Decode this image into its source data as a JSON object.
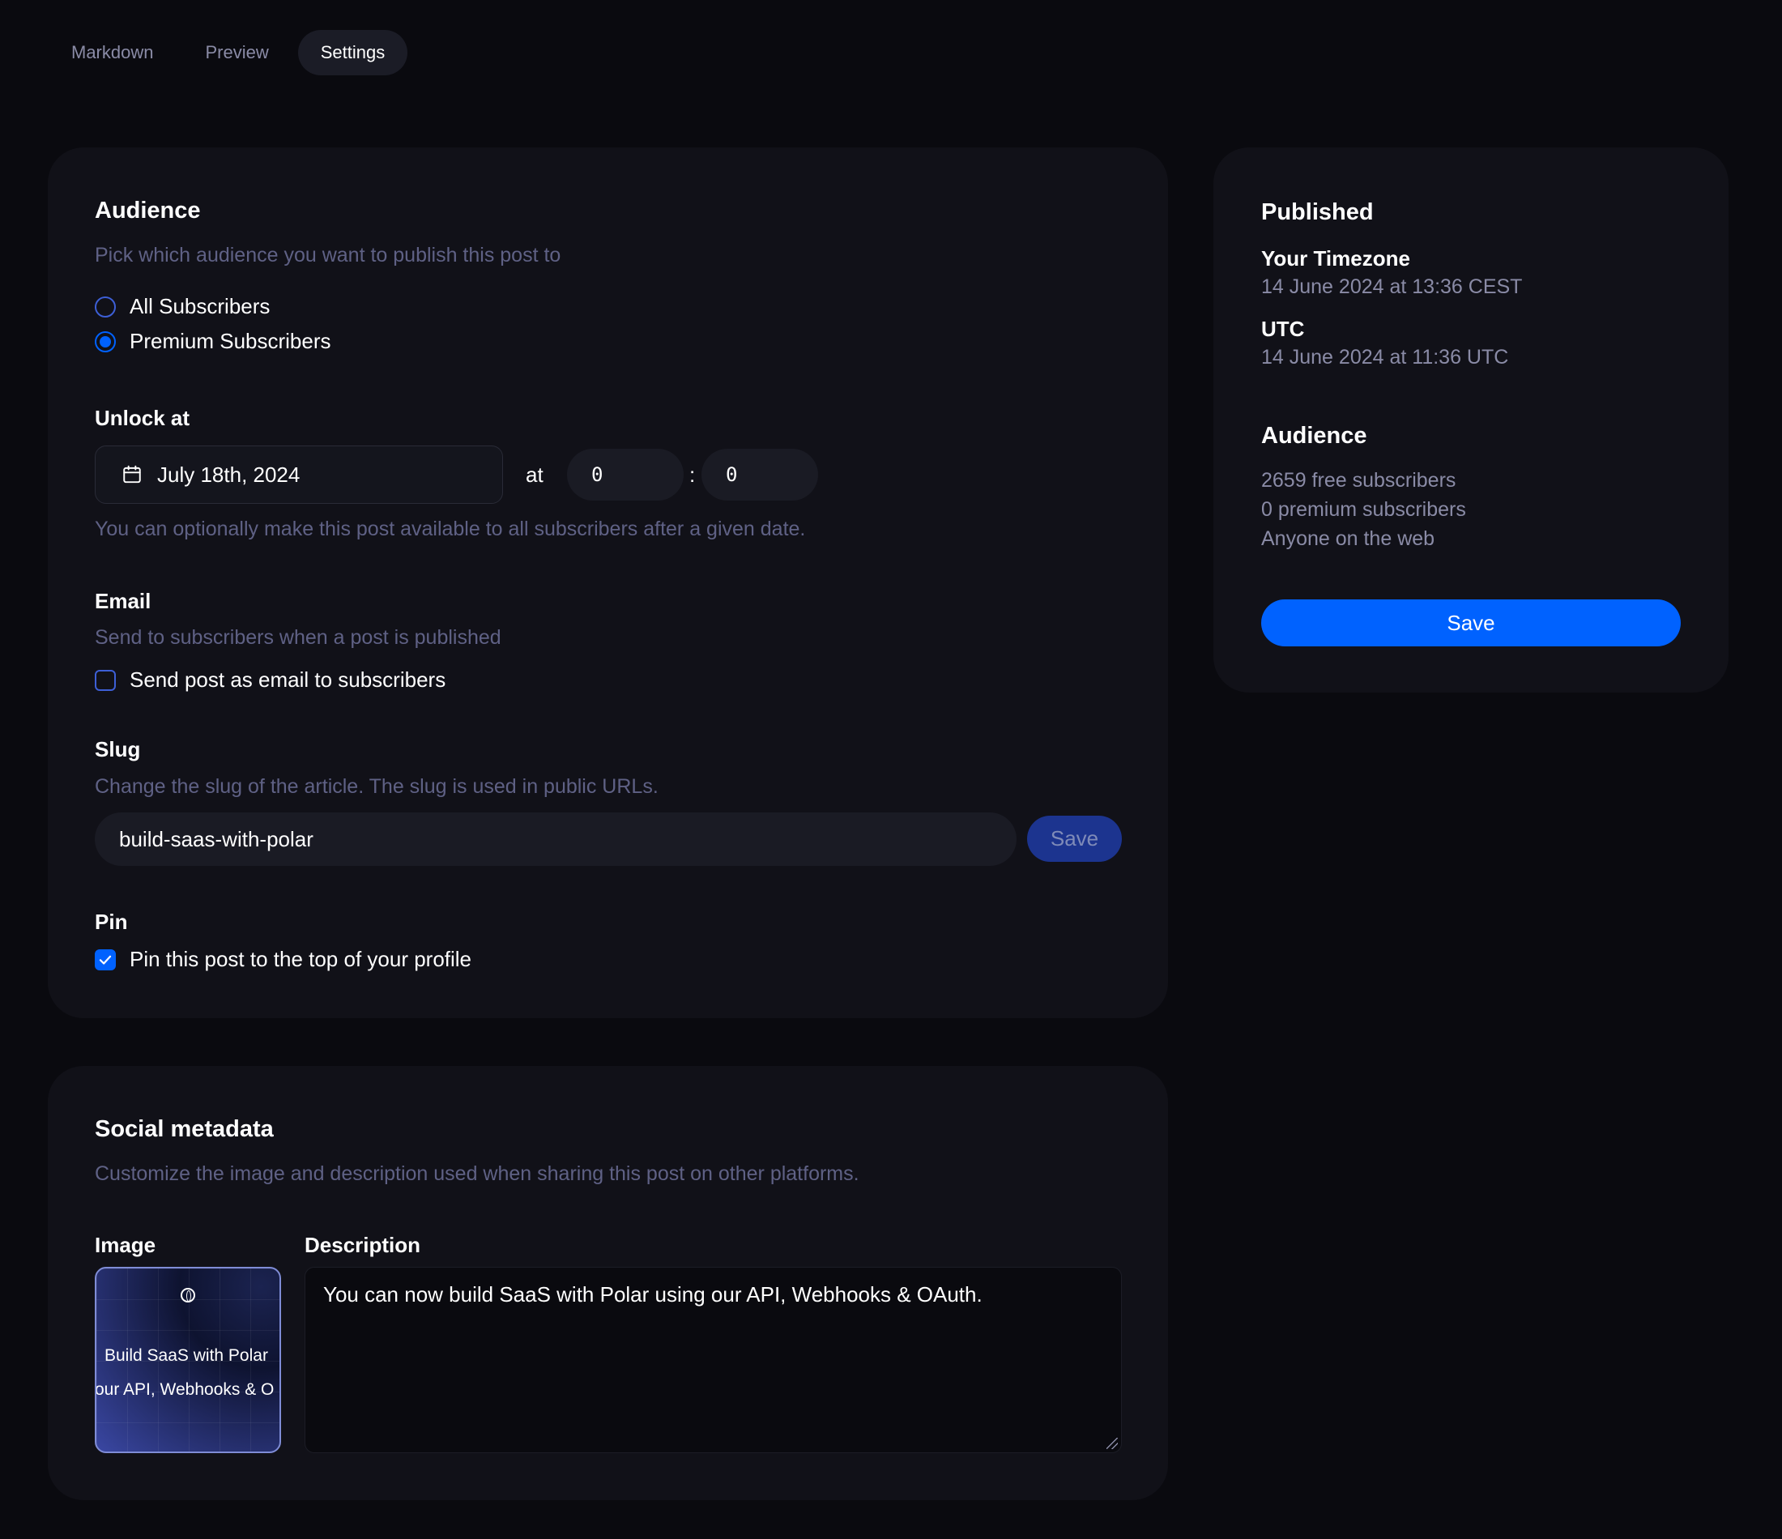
{
  "tabs": [
    {
      "label": "Markdown",
      "active": false
    },
    {
      "label": "Preview",
      "active": false
    },
    {
      "label": "Settings",
      "active": true
    }
  ],
  "audience": {
    "title": "Audience",
    "description": "Pick which audience you want to publish this post to",
    "options": [
      {
        "label": "All Subscribers",
        "checked": false
      },
      {
        "label": "Premium Subscribers",
        "checked": true
      }
    ]
  },
  "unlock": {
    "title": "Unlock at",
    "date": "July 18th, 2024",
    "at_label": "at",
    "hour": "0",
    "separator": ":",
    "minute": "0",
    "help": "You can optionally make this post available to all subscribers after a given date."
  },
  "email": {
    "title": "Email",
    "description": "Send to subscribers when a post is published",
    "checkbox_label": "Send post as email to subscribers",
    "checked": false
  },
  "slug": {
    "title": "Slug",
    "description": "Change the slug of the article. The slug is used in public URLs.",
    "value": "build-saas-with-polar",
    "save_label": "Save"
  },
  "pin": {
    "title": "Pin",
    "checkbox_label": "Pin this post to the top of your profile",
    "checked": true
  },
  "social": {
    "title": "Social metadata",
    "description": "Customize the image and description used when sharing this post on other platforms.",
    "image_label": "Image",
    "image_text_line1": "Build SaaS with Polar",
    "image_text_line2": "our API, Webhooks & O",
    "description_label": "Description",
    "description_value": "You can now build SaaS with Polar using our API, Webhooks & OAuth."
  },
  "published": {
    "title": "Published",
    "your_timezone_label": "Your Timezone",
    "your_timezone_value": "14 June 2024 at 13:36 CEST",
    "utc_label": "UTC",
    "utc_value": "14 June 2024 at 11:36 UTC",
    "audience_title": "Audience",
    "free_subscribers": "2659 free subscribers",
    "premium_subscribers": "0 premium subscribers",
    "web": "Anyone on the web",
    "save_label": "Save"
  },
  "colors": {
    "background": "#0a0a0f",
    "card": "#111118",
    "accent": "#0062ff",
    "muted_text": "#5f6185"
  }
}
